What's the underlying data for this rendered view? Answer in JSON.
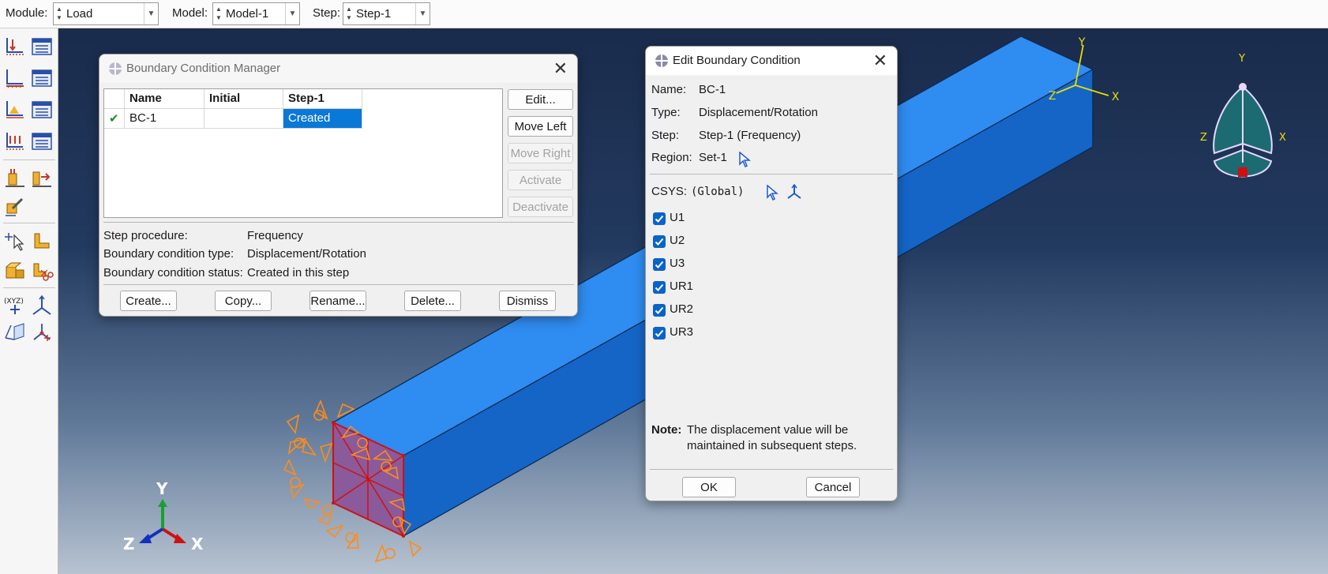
{
  "toolbar": {
    "module_label": "Module:",
    "module_value": "Load",
    "model_label": "Model:",
    "model_value": "Model-1",
    "step_label": "Step:",
    "step_value": "Step-1"
  },
  "viewport": {
    "triad_y": "Y",
    "triad_z": "Z",
    "triad_x": "X",
    "local_y": "Y",
    "local_z": "Z",
    "local_x": "X",
    "view_y": "Y",
    "view_z": "Z",
    "view_x": "X"
  },
  "bc_manager": {
    "title": "Boundary Condition Manager",
    "columns": [
      "Name",
      "Initial",
      "Step-1"
    ],
    "rows": [
      {
        "check": "✔",
        "name": "BC-1",
        "initial": "",
        "step1": "Created"
      }
    ],
    "buttons": {
      "edit": "Edit...",
      "move_left": "Move Left",
      "move_right": "Move Right",
      "activate": "Activate",
      "deactivate": "Deactivate"
    },
    "info": {
      "step_procedure_label": "Step procedure:",
      "step_procedure_value": "Frequency",
      "bc_type_label": "Boundary condition type:",
      "bc_type_value": "Displacement/Rotation",
      "bc_status_label": "Boundary condition status:",
      "bc_status_value": "Created in this step"
    },
    "footer": {
      "create": "Create...",
      "copy": "Copy...",
      "rename": "Rename...",
      "delete": "Delete...",
      "dismiss": "Dismiss"
    }
  },
  "edit_bc": {
    "title": "Edit Boundary Condition",
    "name_label": "Name:",
    "name_value": "BC-1",
    "type_label": "Type:",
    "type_value": "Displacement/Rotation",
    "step_label": "Step:",
    "step_value": "Step-1 (Frequency)",
    "region_label": "Region:",
    "region_value": "Set-1",
    "csys_label": "CSYS:",
    "csys_value": "(Global)",
    "dofs": [
      {
        "label": "U1",
        "checked": true
      },
      {
        "label": "U2",
        "checked": true
      },
      {
        "label": "U3",
        "checked": true
      },
      {
        "label": "UR1",
        "checked": true
      },
      {
        "label": "UR2",
        "checked": true
      },
      {
        "label": "UR3",
        "checked": true
      }
    ],
    "note_label": "Note:",
    "note_line1": "The displacement value will be",
    "note_line2": "maintained in subsequent steps.",
    "ok": "OK",
    "cancel": "Cancel"
  },
  "colors": {
    "accent": "#0a78d7",
    "beam": "#1f7fe0",
    "bc_marker": "#ff8c1a"
  }
}
